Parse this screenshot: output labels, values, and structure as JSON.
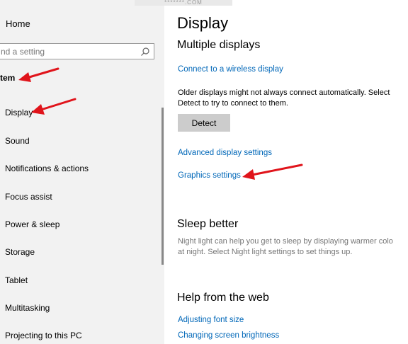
{
  "watermark": "*******.COM",
  "sidebar": {
    "home_label": "Home",
    "search_placeholder": "nd a setting",
    "section_title": "tem",
    "items": [
      {
        "label": "Display"
      },
      {
        "label": "Sound"
      },
      {
        "label": "Notifications & actions"
      },
      {
        "label": "Focus assist"
      },
      {
        "label": "Power & sleep"
      },
      {
        "label": "Storage"
      },
      {
        "label": "Tablet"
      },
      {
        "label": "Multitasking"
      },
      {
        "label": "Projecting to this PC"
      }
    ]
  },
  "main": {
    "title": "Display",
    "multiple_displays": {
      "heading": "Multiple displays",
      "connect_link": "Connect to a wireless display",
      "description_line1": "Older displays might not always connect automatically. Select",
      "description_line2": "Detect to try to connect to them.",
      "detect_button": "Detect",
      "advanced_link": "Advanced display settings",
      "graphics_link": "Graphics settings"
    },
    "sleep_better": {
      "heading": "Sleep better",
      "line1": "Night light can help you get to sleep by displaying warmer colo",
      "line2": "at night. Select Night light settings to set things up."
    },
    "help": {
      "heading": "Help from the web",
      "links": [
        "Adjusting font size",
        "Changing screen brightness"
      ]
    }
  },
  "colors": {
    "link": "#0067b8",
    "sidebar_bg": "#f2f2f2",
    "arrow": "#e0141b",
    "button_bg": "#cccccc"
  }
}
